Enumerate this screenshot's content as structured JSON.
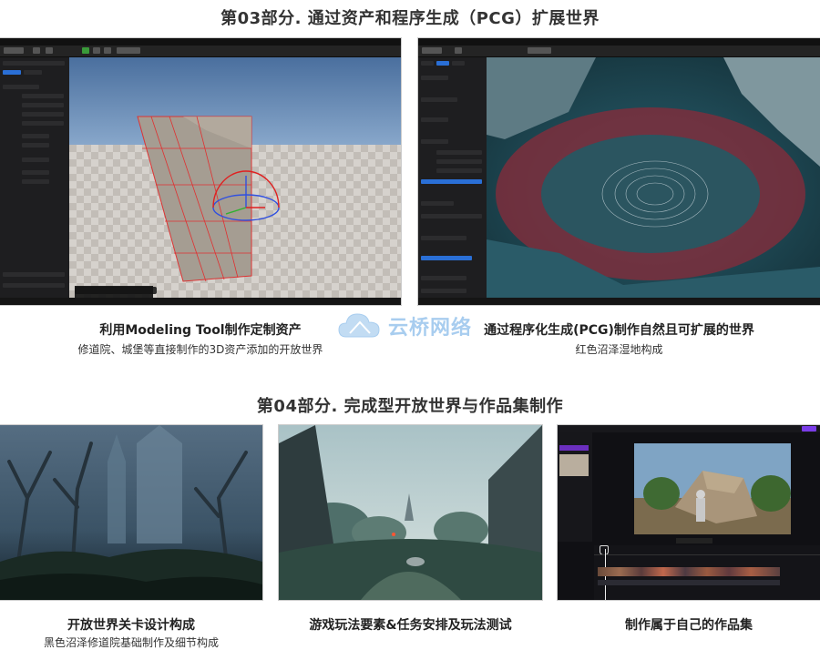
{
  "section3": {
    "title": "第03部分. 通过资产和程序生成（PCG）扩展世界",
    "card1": {
      "caption": "利用Modeling Tool制作定制资产",
      "subcaption": "修道院、城堡等直接制作的3D资产添加的开放世界"
    },
    "card2": {
      "caption": "通过程序化生成(PCG)制作自然且可扩展的世界",
      "subcaption": "红色沼泽湿地构成"
    }
  },
  "watermark": {
    "text": "云桥网络"
  },
  "section4": {
    "title": "第04部分. 完成型开放世界与作品集制作",
    "card1": {
      "caption": "开放世界关卡设计构成",
      "subcaption": "黑色沼泽修道院基础制作及细节构成"
    },
    "card2": {
      "caption": "游戏玩法要素&任务安排及玩法测试"
    },
    "card3": {
      "caption": "制作属于自己的作品集"
    }
  },
  "colors": {
    "sky": "#4a6f9e",
    "grid_floor": "#cfcac5",
    "swamp_red": "#8a2b3a",
    "swamp_teal": "#1f4a56",
    "editor_dark": "#1b1b1d",
    "accent_blue": "#2a6fd6"
  }
}
